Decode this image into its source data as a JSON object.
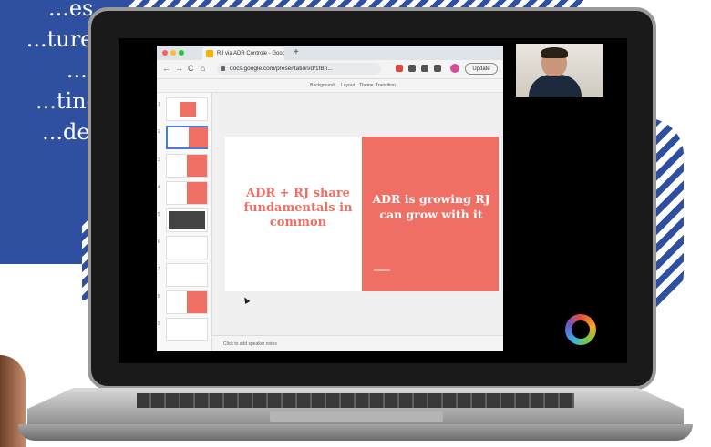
{
  "background_text": {
    "lines": [
      "...es,",
      "...ture,",
      "...e",
      "...ting",
      "...der"
    ]
  },
  "browser": {
    "tab_title": "RJ via ADR Controle - Google...",
    "new_tab_glyph": "+",
    "url": "docs.google.com/presentation/d/1fBn...",
    "update_label": "Update",
    "nav": {
      "back": "←",
      "forward": "→",
      "reload": "C",
      "home": "⌂"
    }
  },
  "slides_toolbar": {
    "background": "Background",
    "layout": "Layout",
    "theme": "Theme",
    "transition": "Transition"
  },
  "filmstrip": {
    "numbers": [
      "1",
      "2",
      "3",
      "4",
      "5",
      "6",
      "7",
      "8",
      "9"
    ]
  },
  "slide": {
    "left_text": "ADR + RJ share fundamentals in common",
    "right_text": "ADR is growing RJ can grow with it"
  },
  "speaker_notes": {
    "placeholder": "Click to add speaker notes"
  },
  "colors": {
    "accent_blue": "#2f4fa0",
    "slide_coral": "#ef6f64"
  },
  "icons": [
    "back-icon",
    "forward-icon",
    "reload-icon",
    "home-icon",
    "lock-icon",
    "logo-ring-icon"
  ]
}
